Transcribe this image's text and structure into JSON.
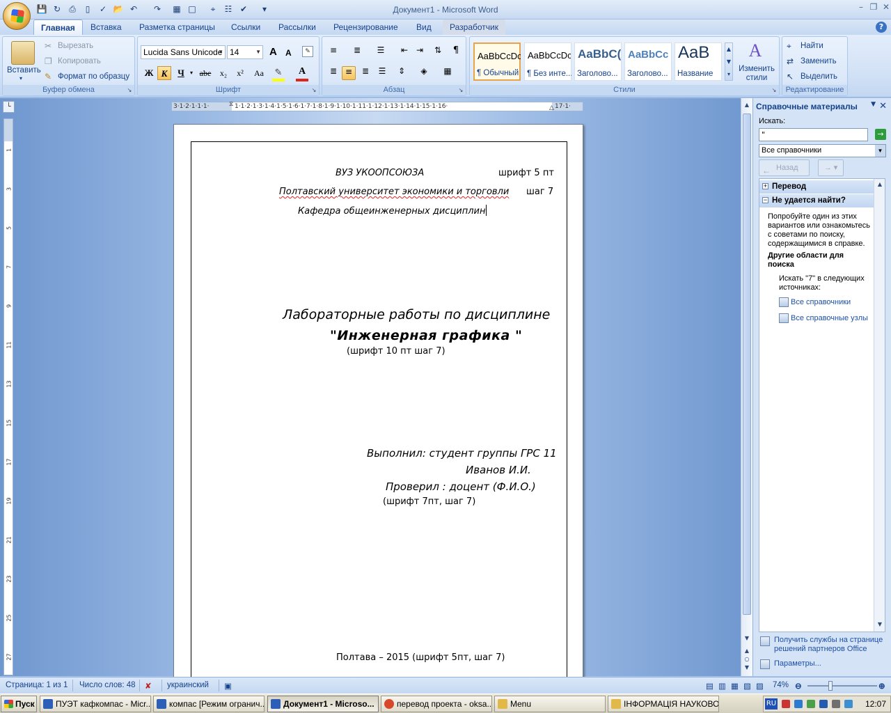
{
  "window": {
    "title": "Документ1 - Microsoft Word"
  },
  "tabs": [
    {
      "label": "Главная",
      "active": true
    },
    {
      "label": "Вставка"
    },
    {
      "label": "Разметка страницы"
    },
    {
      "label": "Ссылки"
    },
    {
      "label": "Рассылки"
    },
    {
      "label": "Рецензирование"
    },
    {
      "label": "Вид"
    },
    {
      "label": "Разработчик"
    }
  ],
  "ribbon": {
    "clipboard": {
      "label": "Буфер обмена",
      "paste": "Вставить",
      "cut": "Вырезать",
      "copy": "Копировать",
      "format_painter": "Формат по образцу"
    },
    "font": {
      "label": "Шрифт",
      "font_name": "Lucida Sans Unicode",
      "font_size": "14",
      "bold": "Ж",
      "italic": "К",
      "underline": "Ч",
      "strike": "abe",
      "subscript": "x₂",
      "superscript": "x²",
      "change_case": "Aa",
      "grow": "A",
      "shrink": "A"
    },
    "paragraph": {
      "label": "Абзац"
    },
    "styles": {
      "label": "Стили",
      "items": [
        {
          "sample": "AaBbCcDc",
          "name": "¶ Обычный",
          "selected": true
        },
        {
          "sample": "AaBbCcDc",
          "name": "¶ Без инте..."
        },
        {
          "sample": "AaBbC(",
          "name": "Заголово..."
        },
        {
          "sample": "AaBbCc",
          "name": "Заголово..."
        },
        {
          "sample": "AaB",
          "name": "Название"
        }
      ],
      "change_styles": "Изменить стили"
    },
    "editing": {
      "label": "Редактирование",
      "find": "Найти",
      "replace": "Заменить",
      "select": "Выделить"
    }
  },
  "document": {
    "line1_left": "ВУЗ УКООПСОЮЗА",
    "line1_right": "шрифт 5 пт",
    "line2_left": "Полтавский университет экономики и торговли",
    "line2_right": "шаг 7",
    "line3": "Кафедра общеинженерных дисциплин",
    "title1": "Лабораторные работы по дисциплине",
    "title2": "\"Инженерная графика \"",
    "title_note": "(шрифт 10 пт       шаг 7)",
    "performed": "Выполнил: студент группы ГРС 11",
    "student": "Иванов И.И.",
    "checked": "Проверил : доцент (Ф.И.О.)",
    "note2": "(шрифт 7пт, шаг 7)",
    "footer": "Полтава – 2015   (шрифт 5пт, шаг 7)"
  },
  "task_pane": {
    "title": "Справочные материалы",
    "search_label": "Искать:",
    "search_value": "\"",
    "source_select": "Все справочники",
    "back": "Назад",
    "section_translate": "Перевод",
    "section_notfound": "Не удается найти?",
    "hint": "Попробуйте один из этих вариантов или ознакомьтесь с советами по поиску, содержащимися в справке.",
    "other_areas": "Другие области для поиска",
    "search_in": "Искать \"7\" в следующих источниках:",
    "link1": "Все справочники",
    "link2": "Все справочные узлы",
    "partner_services": "Получить службы на странице решений партнеров Office",
    "settings": "Параметры..."
  },
  "status": {
    "page": "Страница: 1 из 1",
    "words": "Число слов: 48",
    "language": "украинский",
    "zoom": "74%"
  },
  "taskbar": {
    "start": "Пуск",
    "items": [
      {
        "label": "ПУЭТ кафкомпас - Micr...",
        "color": "#2d5fb8"
      },
      {
        "label": "компас [Режим огранич...",
        "color": "#2d5fb8"
      },
      {
        "label": "Документ1 - Microso...",
        "color": "#2d5fb8",
        "active": true
      },
      {
        "label": "перевод проекта - oksa...",
        "color": "#d9472b"
      },
      {
        "label": "Menu",
        "color": "#e0b94a"
      },
      {
        "label": "ІНФОРМАЦІЯ НАУКОВО...",
        "color": "#e0b94a"
      }
    ],
    "lang": "RU",
    "clock": "12:07"
  },
  "colors": {
    "ribbon_text": "#15428b",
    "accent_selected_style": "#e7a44b",
    "font_color_bar": "#e0241b",
    "highlight_bar": "#ffff00"
  }
}
